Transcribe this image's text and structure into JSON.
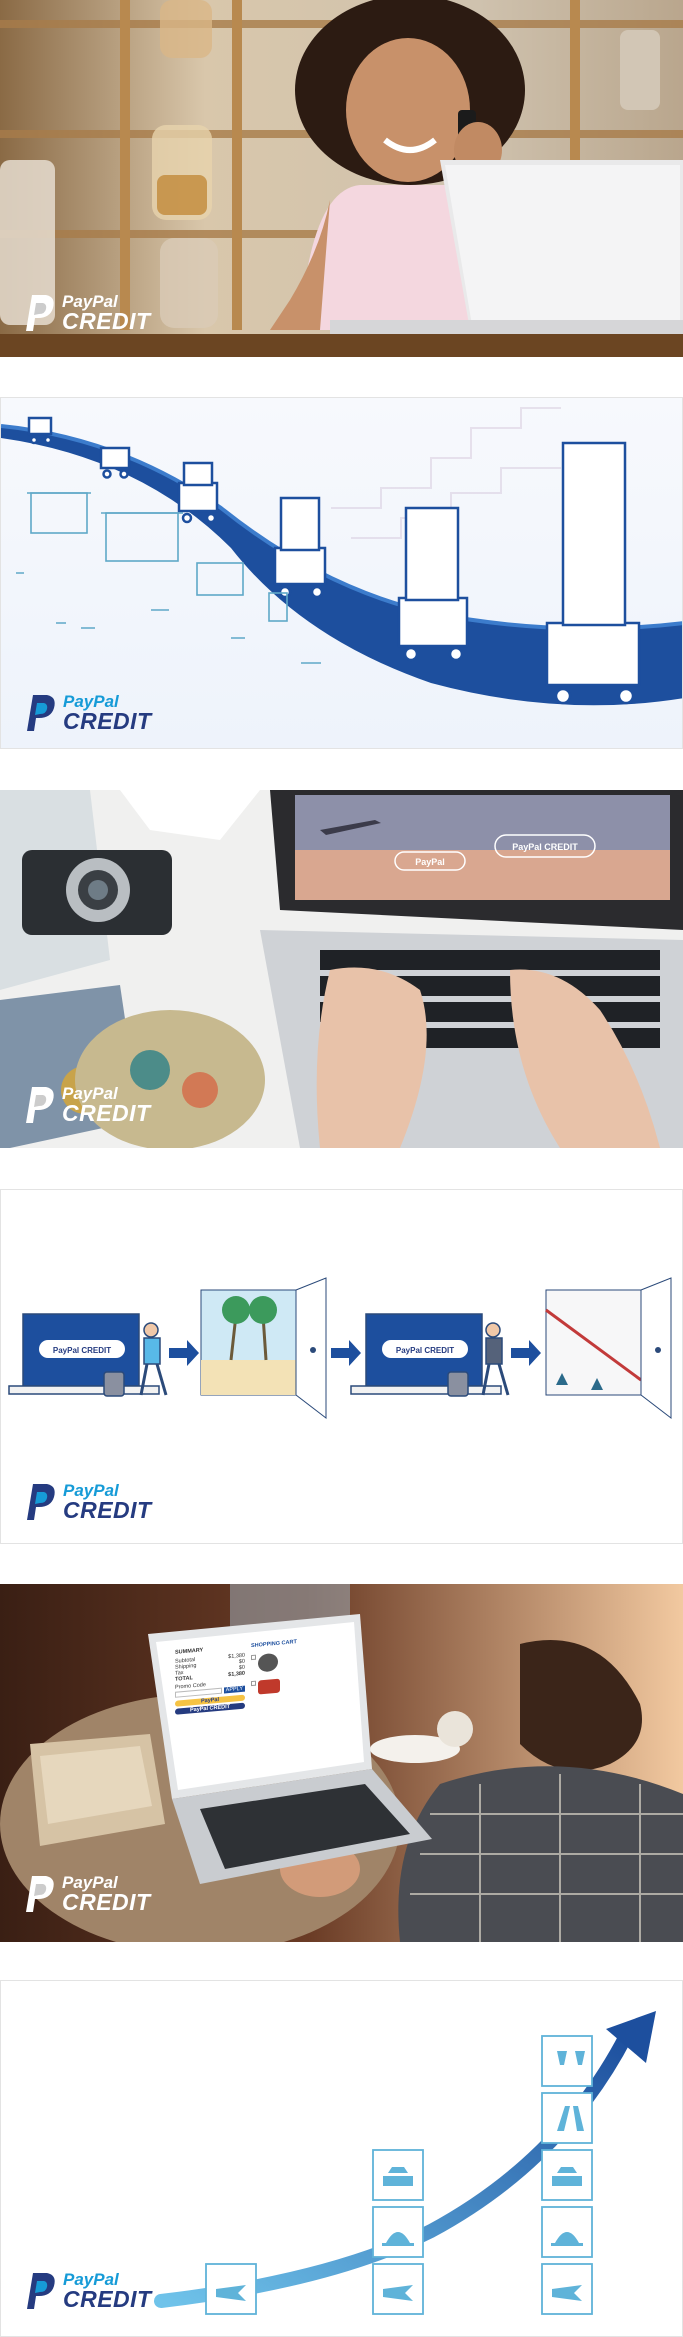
{
  "brand": {
    "paypal": "PayPal",
    "credit": "CREDIT"
  },
  "laptop_buttons": {
    "pay_small": "PayPal",
    "credit_small": "PayPal CREDIT",
    "credit_button": "PayPal CREDIT"
  },
  "cart": {
    "summary_title": "SUMMARY",
    "cart_title": "SHOPPING CART",
    "rows": [
      {
        "label": "Subtotal",
        "value": "$1,380"
      },
      {
        "label": "Shipping",
        "value": "$0"
      },
      {
        "label": "Tax",
        "value": "$0"
      },
      {
        "label": "TOTAL",
        "value": "$1,380"
      }
    ],
    "promo_label": "Promo Code",
    "apply": "APPLY",
    "pay_button": "PayPal",
    "credit_button": "PayPal CREDIT"
  },
  "colors": {
    "brand_dark": "#253b80",
    "brand_light": "#169bd7",
    "wave": "#1d4f9e"
  },
  "icons": [
    "shopping-cart-icon",
    "storefront-icon",
    "airplane-ticket-icon",
    "car-key-icon",
    "hotel-bell-icon",
    "palm-tree-icon",
    "wine-glasses-icon",
    "growth-arrow-icon"
  ]
}
